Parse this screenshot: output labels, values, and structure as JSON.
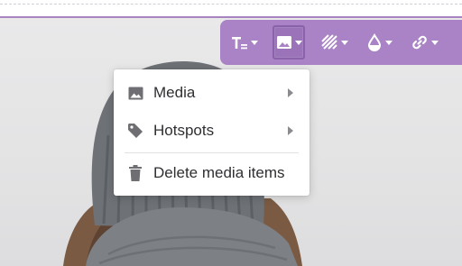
{
  "toolbar": {
    "buttons": [
      {
        "name": "text-style",
        "icon": "text-size-icon"
      },
      {
        "name": "image",
        "icon": "image-icon",
        "active": true
      },
      {
        "name": "pattern",
        "icon": "stripes-icon"
      },
      {
        "name": "fill",
        "icon": "drop-icon"
      },
      {
        "name": "link",
        "icon": "link-icon"
      }
    ],
    "accent_color": "#a983c6"
  },
  "menu": {
    "items": [
      {
        "label": "Media",
        "icon": "image-icon",
        "has_submenu": true
      },
      {
        "label": "Hotspots",
        "icon": "tag-icon",
        "has_submenu": true
      },
      {
        "label": "Delete media items",
        "icon": "trash-icon",
        "has_submenu": false
      }
    ]
  }
}
